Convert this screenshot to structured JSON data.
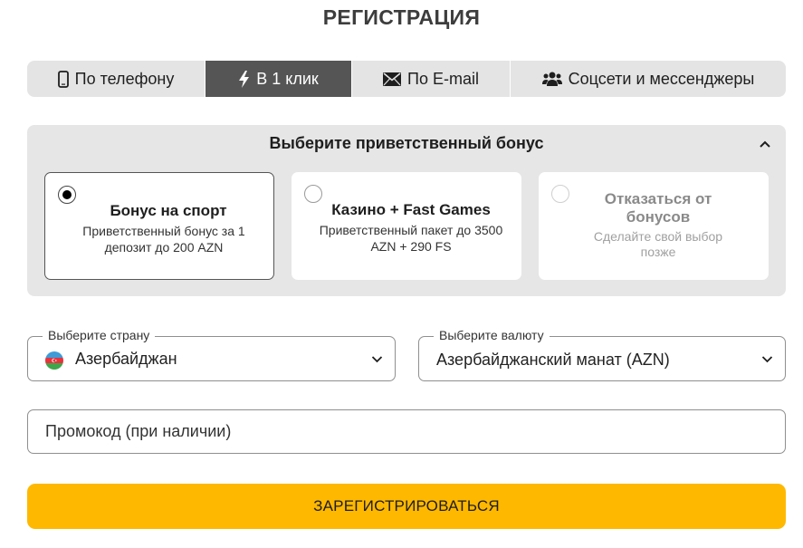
{
  "title": "РЕГИСТРАЦИЯ",
  "tabs": [
    {
      "label": "По телефону",
      "icon": "phone-icon"
    },
    {
      "label": "В 1 клик",
      "icon": "lightning-icon",
      "active": true
    },
    {
      "label": "По E-mail",
      "icon": "envelope-icon"
    },
    {
      "label": "Соцсети и мессенджеры",
      "icon": "users-icon"
    }
  ],
  "bonus": {
    "heading": "Выберите приветственный бонус",
    "options": [
      {
        "title": "Бонус на спорт",
        "description": "Приветственный бонус за 1 депозит до 200 AZN",
        "selected": true
      },
      {
        "title": "Казино + Fast Games",
        "description": "Приветственный пакет до 3500 AZN + 290 FS",
        "selected": false
      },
      {
        "title": "Отказаться от бонусов",
        "description": "Сделайте свой выбор позже",
        "selected": false
      }
    ]
  },
  "country": {
    "label": "Выберите страну",
    "value": "Азербайджан"
  },
  "currency": {
    "label": "Выберите валюту",
    "value": "Азербайджанский манат (AZN)"
  },
  "promo": {
    "placeholder": "Промокод (при наличии)"
  },
  "submit_label": "ЗАРЕГИСТРИРОВАТЬСЯ",
  "colors": {
    "accent": "#ffb800",
    "active_tab": "#555555",
    "panel": "#e6e6e6"
  }
}
